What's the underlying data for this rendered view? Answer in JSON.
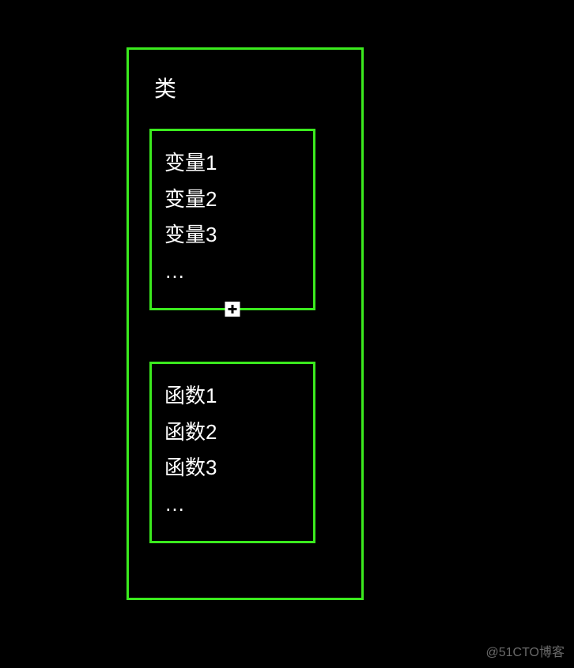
{
  "diagram": {
    "title": "类",
    "variables": {
      "items": [
        "变量1",
        "变量2",
        "变量3",
        "…"
      ]
    },
    "functions": {
      "items": [
        "函数1",
        "函数2",
        "函数3",
        "…"
      ]
    }
  },
  "watermark": "@51CTO博客"
}
